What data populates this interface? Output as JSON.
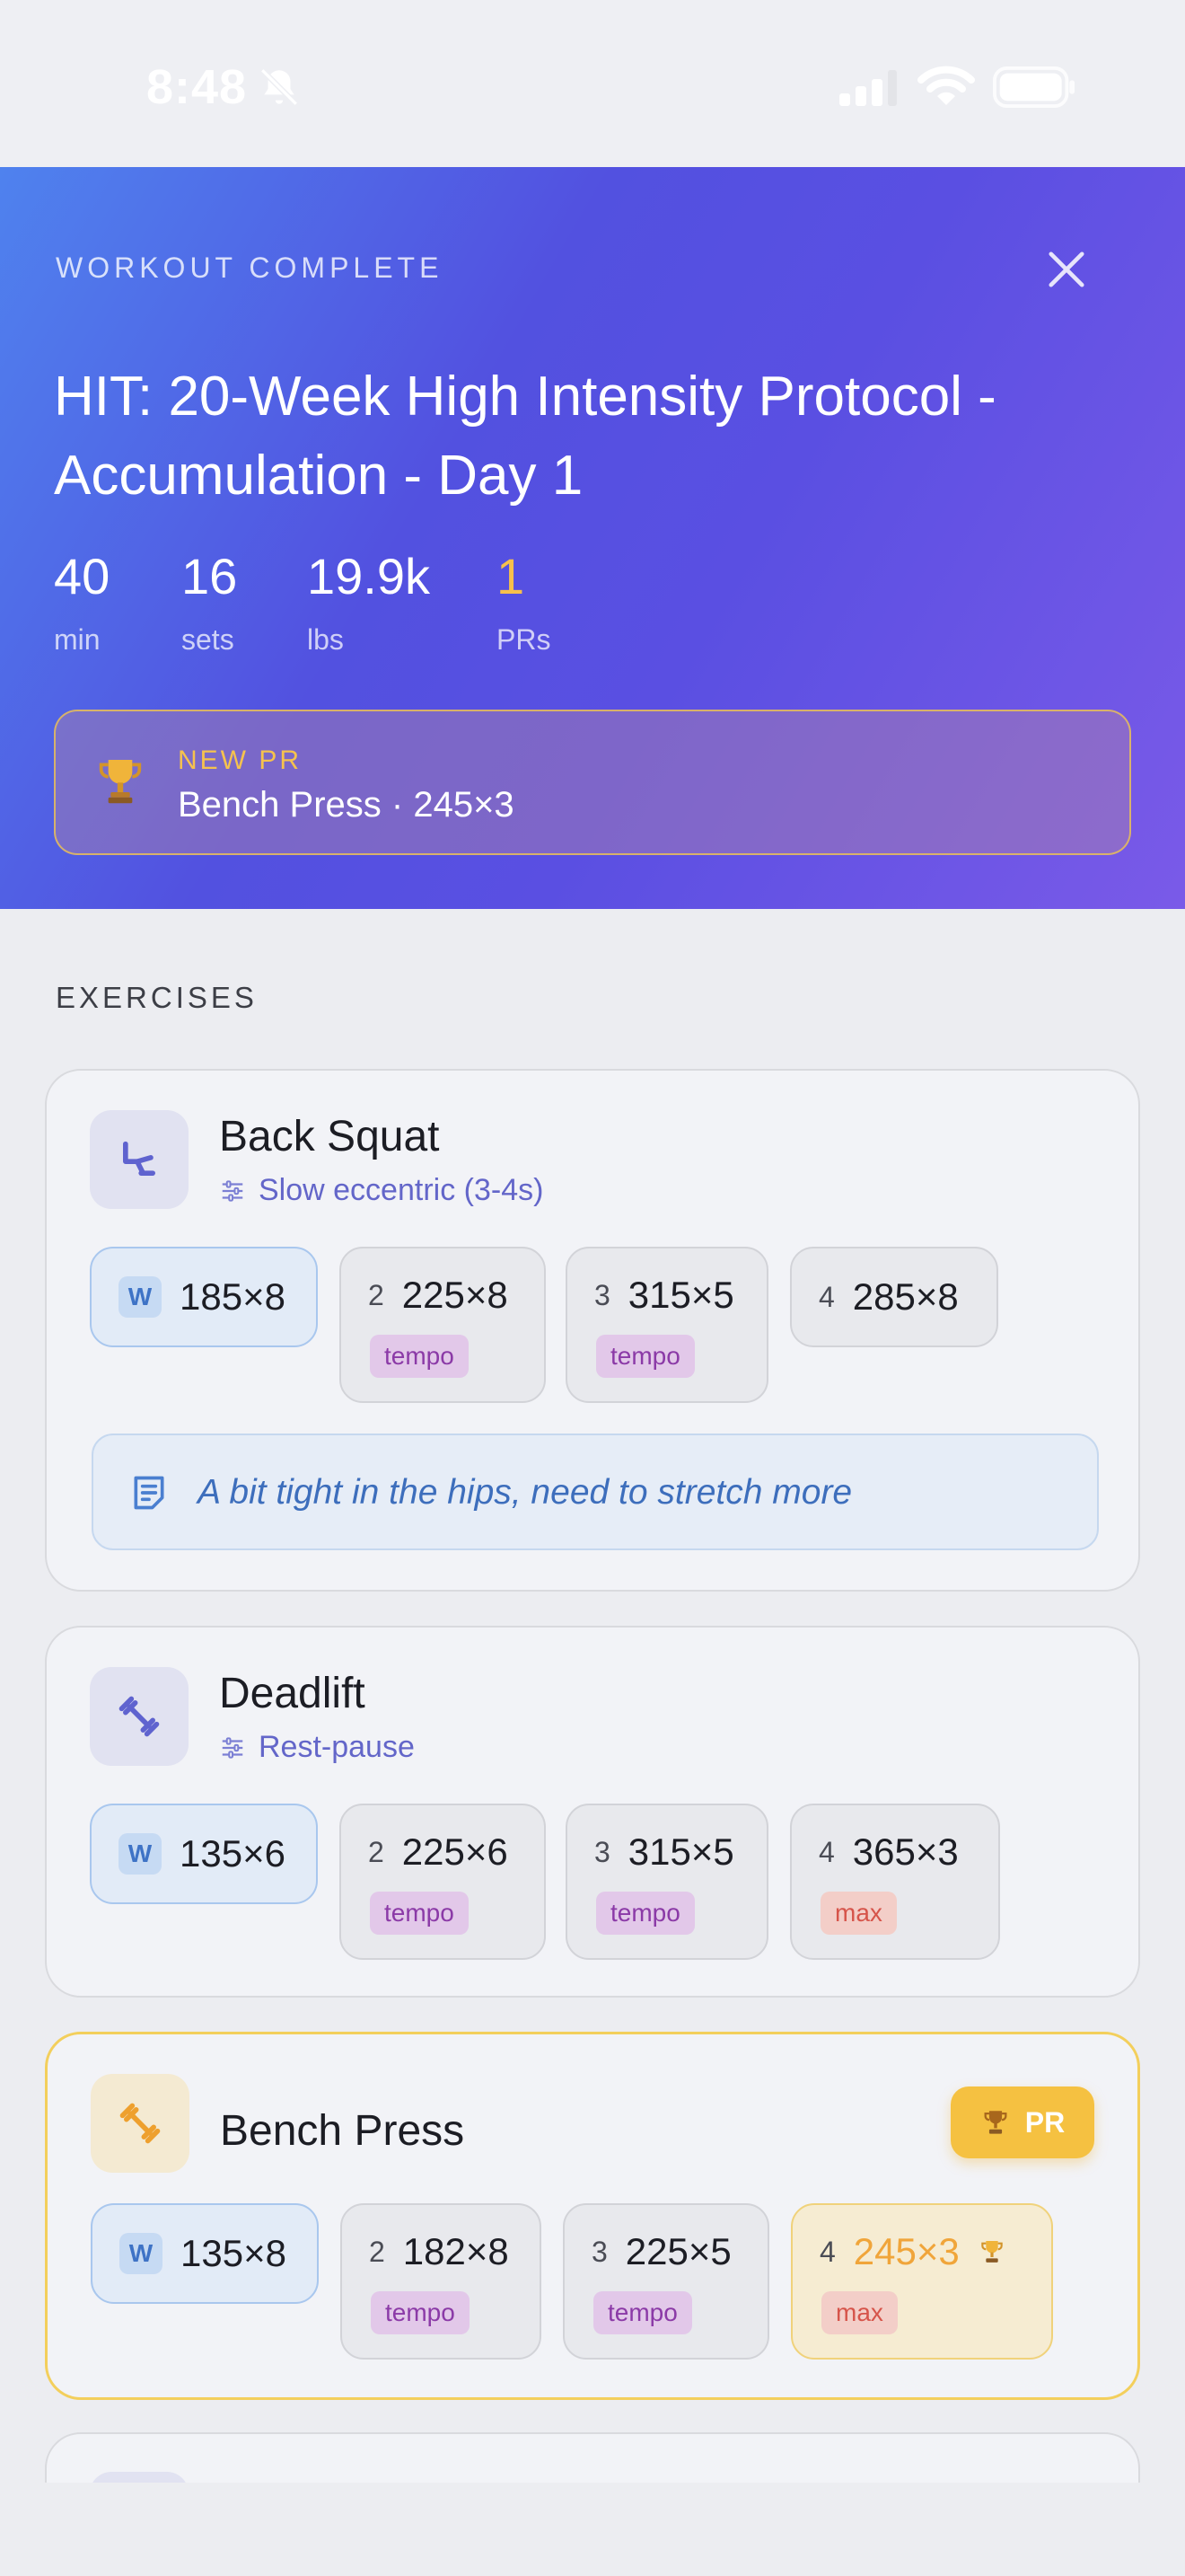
{
  "status_bar": {
    "time": "8:48",
    "icons": [
      "bell-off-icon",
      "signal-icon",
      "wifi-icon",
      "battery-icon"
    ]
  },
  "hero": {
    "eyebrow": "WORKOUT COMPLETE",
    "title": "HIT: 20-Week High Intensity Protocol - Accumulation - Day 1",
    "stats": [
      {
        "value": "40",
        "label": "min"
      },
      {
        "value": "16",
        "label": "sets"
      },
      {
        "value": "19.9k",
        "label": "lbs"
      },
      {
        "value": "1",
        "label": "PRs"
      }
    ],
    "pr_banner": {
      "eyebrow": "NEW PR",
      "text": "Bench Press · 245×3"
    }
  },
  "colors": {
    "accent": "#5251e0",
    "gold": "#f5c141",
    "tempo": "#8b3aa7",
    "max": "#d6544a"
  },
  "section_label": "EXERCISES",
  "exercises": [
    {
      "name": "Back Squat",
      "icon": "leg-press-icon",
      "technique": "Slow eccentric (3-4s)",
      "sets": [
        {
          "num": "W",
          "value": "185×8",
          "tag": ""
        },
        {
          "num": "2",
          "value": "225×8",
          "tag": "tempo"
        },
        {
          "num": "3",
          "value": "315×5",
          "tag": "tempo"
        },
        {
          "num": "4",
          "value": "285×8",
          "tag": ""
        }
      ],
      "note": "A bit tight in the hips, need to stretch more"
    },
    {
      "name": "Deadlift",
      "icon": "dumbbell-icon",
      "technique": "Rest-pause",
      "sets": [
        {
          "num": "W",
          "value": "135×6",
          "tag": ""
        },
        {
          "num": "2",
          "value": "225×6",
          "tag": "tempo"
        },
        {
          "num": "3",
          "value": "315×5",
          "tag": "tempo"
        },
        {
          "num": "4",
          "value": "365×3",
          "tag": "max"
        }
      ]
    },
    {
      "name": "Bench Press",
      "icon": "dumbbell-icon",
      "badge": "PR",
      "sets": [
        {
          "num": "W",
          "value": "135×8",
          "tag": ""
        },
        {
          "num": "2",
          "value": "182×8",
          "tag": "tempo"
        },
        {
          "num": "3",
          "value": "225×5",
          "tag": "tempo"
        },
        {
          "num": "4",
          "value": "245×3",
          "tag": "max"
        }
      ]
    }
  ]
}
